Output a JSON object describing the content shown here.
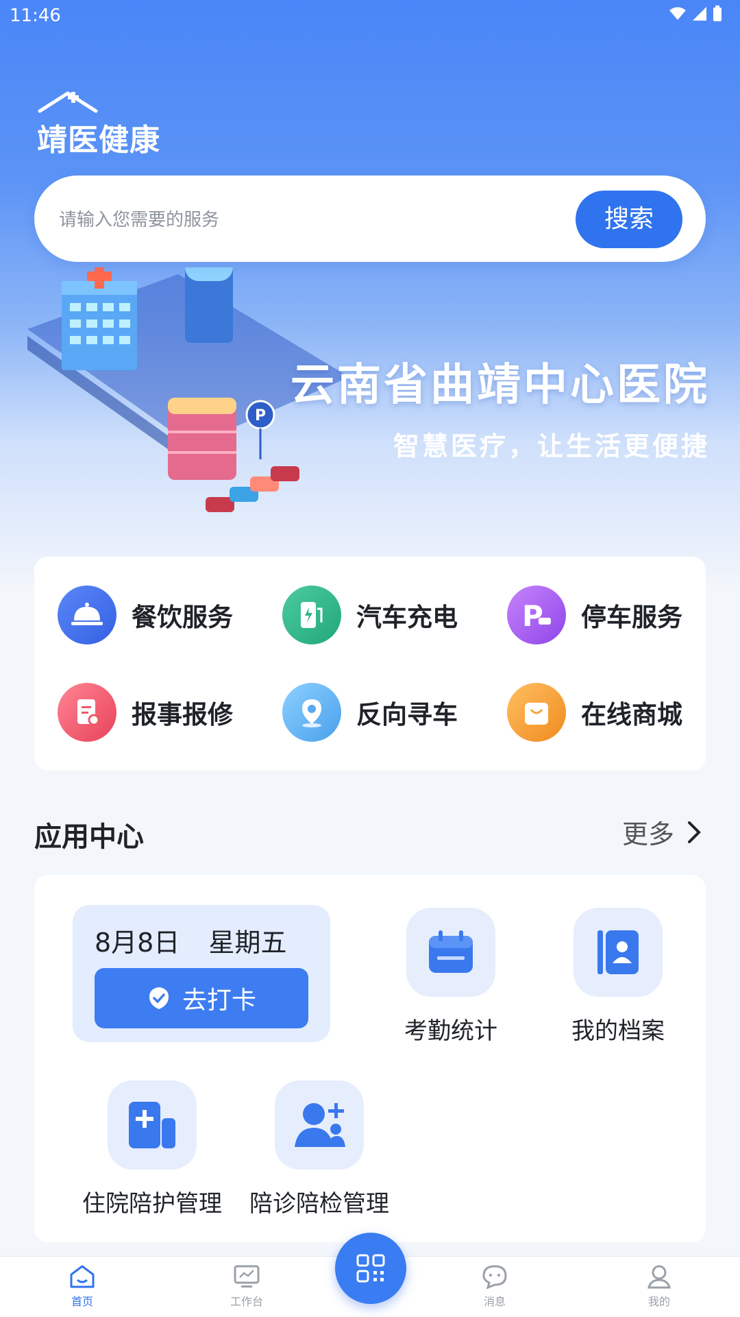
{
  "status": {
    "time": "11:46"
  },
  "app": {
    "logo_text": "靖医健康"
  },
  "search": {
    "placeholder": "请输入您需要的服务",
    "button": "搜索"
  },
  "hero": {
    "title": "云南省曲靖中心医院",
    "subtitle": "智慧医疗，让生活更便捷",
    "building_sign": "医院"
  },
  "services": [
    {
      "label": "餐饮服务",
      "icon": "cloche-icon",
      "color": "#3d6ff0"
    },
    {
      "label": "汽车充电",
      "icon": "ev-charger-icon",
      "color": "#2fb58a"
    },
    {
      "label": "停车服务",
      "icon": "parking-icon",
      "color": "#a35cf0"
    },
    {
      "label": "报事报修",
      "icon": "report-repair-icon",
      "color": "#f0566a"
    },
    {
      "label": "反向寻车",
      "icon": "location-pin-icon",
      "color": "#56a9f0"
    },
    {
      "label": "在线商城",
      "icon": "shopping-bag-icon",
      "color": "#f5a23a"
    }
  ],
  "app_center": {
    "title": "应用中心",
    "more": "更多",
    "checkin": {
      "date": "8月8日",
      "weekday": "星期五",
      "button": "去打卡"
    },
    "apps": [
      {
        "label": "考勤统计",
        "icon": "calendar-icon"
      },
      {
        "label": "我的档案",
        "icon": "profile-card-icon"
      },
      {
        "label": "住院陪护管理",
        "icon": "medical-plus-icon"
      },
      {
        "label": "陪诊陪检管理",
        "icon": "add-person-icon"
      }
    ]
  },
  "tabbar": {
    "home": "首页",
    "workbench": "工作台",
    "messages": "消息",
    "mine": "我的"
  },
  "colors": {
    "primary": "#2f73ee",
    "background": "#f3f6fb"
  }
}
